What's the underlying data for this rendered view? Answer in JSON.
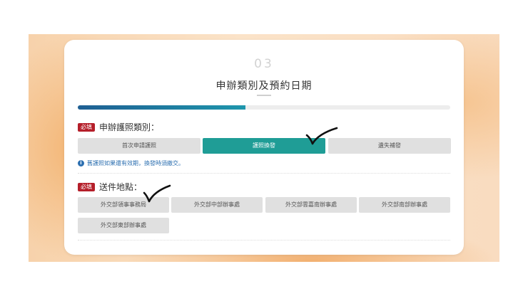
{
  "step": {
    "number": "03",
    "title": "申辦類別及預約日期",
    "progress_fraction": 0.45
  },
  "required_badge": "必填",
  "application_type": {
    "label": "申辦護照類別：",
    "options": [
      "首次申請護照",
      "護照換發",
      "遺失補發"
    ],
    "selected": "護照換發"
  },
  "note": "舊護照如果還有效期，換發時須繳交。",
  "delivery": {
    "label": "送件地點：",
    "options": [
      "外交部領事事務局",
      "外交部中部辦事處",
      "外交部雲嘉南辦事處",
      "外交部南部辦事處",
      "外交部東部辦事處"
    ]
  },
  "colors": {
    "accent_teal": "#1f9d96",
    "required_red": "#b51f2a",
    "progress_blue": "#1f5f93",
    "note_blue": "#2c6fb0"
  }
}
